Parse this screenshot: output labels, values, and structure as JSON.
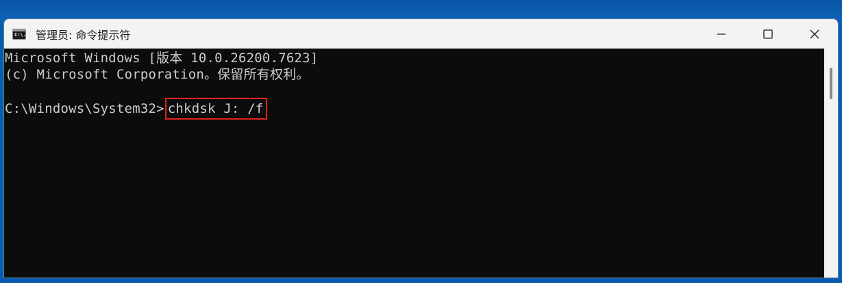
{
  "window": {
    "title": "管理员: 命令提示符",
    "icon": "cmd-icon",
    "icon_text": "C:\\."
  },
  "controls": {
    "minimize": "minimize-icon",
    "maximize": "maximize-icon",
    "close": "close-icon"
  },
  "console": {
    "lines": [
      "Microsoft Windows [版本 10.0.26200.7623]",
      "(c) Microsoft Corporation。保留所有权利。",
      ""
    ],
    "prompt": "C:\\Windows\\System32>",
    "command": "chkdsk J: /f"
  },
  "colors": {
    "console_bg": "#0c0c0c",
    "console_text": "#cccccc",
    "highlight": "#e2231a",
    "titlebar_bg": "#f3f3f3",
    "desktop_bg": "#0b5cad"
  }
}
